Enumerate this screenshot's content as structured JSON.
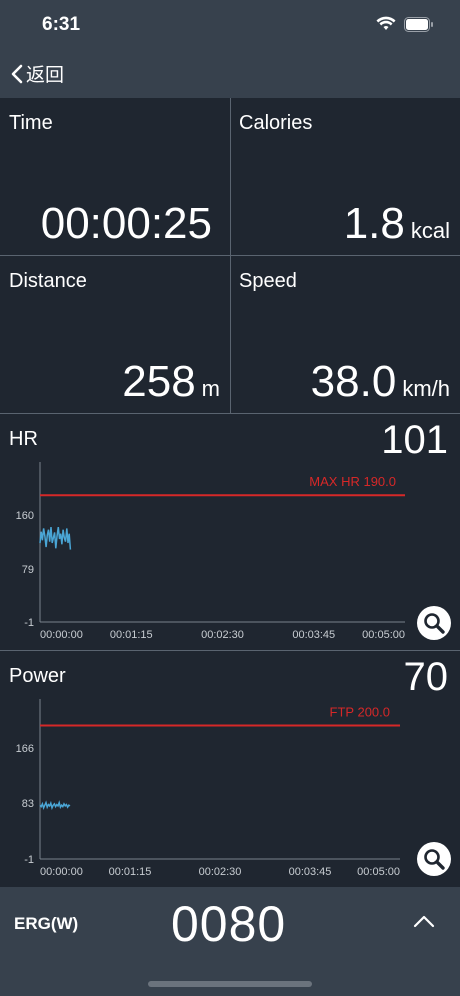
{
  "status_bar": {
    "time": "6:31"
  },
  "nav": {
    "back_label": "返回"
  },
  "tiles": {
    "time": {
      "label": "Time",
      "value": "00:00:25",
      "unit": ""
    },
    "calories": {
      "label": "Calories",
      "value": "1.8",
      "unit": "kcal"
    },
    "distance": {
      "label": "Distance",
      "value": "258",
      "unit": "m"
    },
    "speed": {
      "label": "Speed",
      "value": "38.0",
      "unit": "km/h"
    }
  },
  "hr_panel": {
    "title": "HR",
    "current": "101"
  },
  "power_panel": {
    "title": "Power",
    "current": "70"
  },
  "bottom_bar": {
    "mode_label": "ERG(W)",
    "target_value": "0080"
  },
  "colors": {
    "limit_line": "#d62828",
    "series": "#4aa6d6",
    "axis": "#7a838d"
  },
  "chart_data": [
    {
      "type": "line",
      "title": "HR",
      "x_ticks": [
        "00:00:00",
        "00:01:15",
        "00:02:30",
        "00:03:45",
        "00:05:00"
      ],
      "y_ticks": [
        "160",
        "79",
        "-1"
      ],
      "ylim": [
        -1,
        240
      ],
      "xlim": [
        0,
        300
      ],
      "reference_line": {
        "label": "MAX HR 190.0",
        "value": 190.0
      },
      "series": [
        {
          "x": [
            0,
            1,
            2,
            3,
            4,
            5,
            6,
            7,
            8,
            9,
            10,
            11,
            12,
            13,
            14,
            15,
            16,
            17,
            18,
            19,
            20,
            21,
            22,
            23,
            24,
            25
          ],
          "values": [
            118,
            135,
            122,
            140,
            128,
            112,
            130,
            138,
            120,
            142,
            118,
            126,
            134,
            110,
            128,
            142,
            124,
            132,
            116,
            138,
            126,
            120,
            140,
            118,
            132,
            108
          ]
        }
      ]
    },
    {
      "type": "line",
      "title": "Power",
      "x_ticks": [
        "00:00:00",
        "00:01:15",
        "00:02:30",
        "00:03:45",
        "00:05:00"
      ],
      "y_ticks": [
        "166",
        "83",
        "-1"
      ],
      "ylim": [
        -1,
        240
      ],
      "xlim": [
        0,
        300
      ],
      "reference_line": {
        "label": "FTP 200.0",
        "value": 200.0
      },
      "series": [
        {
          "x": [
            0,
            1,
            2,
            3,
            4,
            5,
            6,
            7,
            8,
            9,
            10,
            11,
            12,
            13,
            14,
            15,
            16,
            17,
            18,
            19,
            20,
            21,
            22,
            23,
            24,
            25
          ],
          "values": [
            80,
            78,
            82,
            76,
            80,
            84,
            77,
            81,
            79,
            83,
            76,
            80,
            82,
            78,
            81,
            79,
            84,
            77,
            80,
            78,
            82,
            79,
            81,
            77,
            80,
            79
          ]
        }
      ]
    }
  ]
}
